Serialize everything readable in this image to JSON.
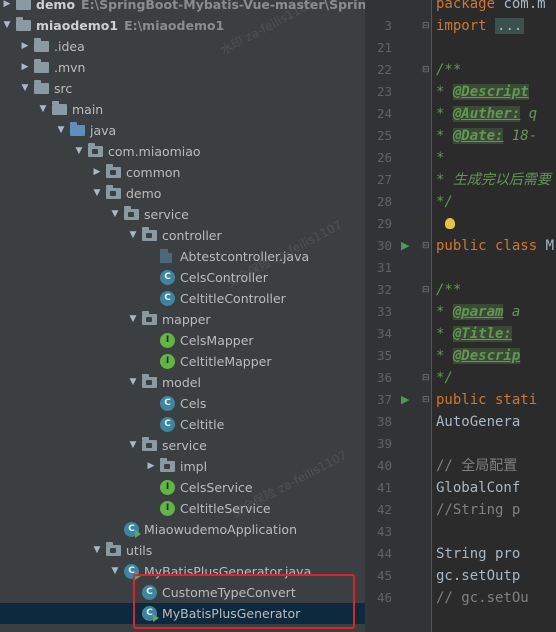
{
  "tree": {
    "items": [
      {
        "label": "demo",
        "path": "E:\\SpringBoot-Mybatis-Vue-master\\SpringBoot",
        "type": "module",
        "arrow": "right",
        "depth": 0,
        "bold": true
      },
      {
        "label": "miaodemo1",
        "path": "E:\\miaodemo1",
        "type": "module",
        "arrow": "down",
        "depth": 0,
        "bold": true
      },
      {
        "label": ".idea",
        "type": "folder",
        "arrow": "right",
        "depth": 1
      },
      {
        "label": ".mvn",
        "type": "folder",
        "arrow": "right",
        "depth": 1
      },
      {
        "label": "src",
        "type": "folder",
        "arrow": "down",
        "depth": 1
      },
      {
        "label": "main",
        "type": "folder",
        "arrow": "down",
        "depth": 2
      },
      {
        "label": "java",
        "type": "folder-blue",
        "arrow": "down",
        "depth": 3
      },
      {
        "label": "com.miaomiao",
        "type": "package",
        "arrow": "down",
        "depth": 4
      },
      {
        "label": "common",
        "type": "package",
        "arrow": "right",
        "depth": 5
      },
      {
        "label": "demo",
        "type": "package",
        "arrow": "down",
        "depth": 5
      },
      {
        "label": "service",
        "type": "package",
        "arrow": "down",
        "depth": 6
      },
      {
        "label": "controller",
        "type": "package",
        "arrow": "down",
        "depth": 7
      },
      {
        "label": "Abtestcontroller.java",
        "type": "java-file",
        "arrow": "",
        "depth": 8
      },
      {
        "label": "CelsController",
        "type": "class",
        "arrow": "",
        "depth": 8
      },
      {
        "label": "CeltitleController",
        "type": "class",
        "arrow": "",
        "depth": 8
      },
      {
        "label": "mapper",
        "type": "package",
        "arrow": "down",
        "depth": 7
      },
      {
        "label": "CelsMapper",
        "type": "interface",
        "arrow": "",
        "depth": 8
      },
      {
        "label": "CeltitleMapper",
        "type": "interface",
        "arrow": "",
        "depth": 8
      },
      {
        "label": "model",
        "type": "package",
        "arrow": "down",
        "depth": 7
      },
      {
        "label": "Cels",
        "type": "class",
        "arrow": "",
        "depth": 8
      },
      {
        "label": "Celtitle",
        "type": "class",
        "arrow": "",
        "depth": 8
      },
      {
        "label": "service",
        "type": "package",
        "arrow": "down",
        "depth": 7
      },
      {
        "label": "impl",
        "type": "package",
        "arrow": "right",
        "depth": 8
      },
      {
        "label": "CelsService",
        "type": "interface",
        "arrow": "",
        "depth": 8
      },
      {
        "label": "CeltitleService",
        "type": "interface",
        "arrow": "",
        "depth": 8
      },
      {
        "label": "MiaowudemoApplication",
        "type": "runnable-class",
        "arrow": "",
        "depth": 6
      },
      {
        "label": "utils",
        "type": "package",
        "arrow": "down",
        "depth": 5
      },
      {
        "label": "MyBatisPlusGenerator.java",
        "type": "runnable-class",
        "arrow": "down",
        "depth": 6
      },
      {
        "label": "CustomeTypeConvert",
        "type": "class",
        "arrow": "",
        "depth": 7
      },
      {
        "label": "MyBatisPlusGenerator",
        "type": "runnable-class",
        "arrow": "",
        "depth": 7,
        "selected": true
      }
    ],
    "watermarks": [
      "水印 za-feilis1107",
      "安全保险 za-feilis1107",
      "安全保险 za-feilis1107"
    ]
  },
  "editor": {
    "lines": [
      {
        "num": "",
        "segments": [
          {
            "t": "kw",
            "v": "package "
          },
          {
            "t": "",
            "v": "com.m"
          }
        ]
      },
      {
        "num": "3",
        "segments": [
          {
            "t": "kw",
            "v": "import "
          },
          {
            "t": "fold",
            "v": "..."
          }
        ]
      },
      {
        "num": "21",
        "segments": []
      },
      {
        "num": "22",
        "segments": [
          {
            "t": "cm",
            "v": "/**"
          }
        ]
      },
      {
        "num": "23",
        "segments": [
          {
            "t": "cm",
            "v": " * "
          },
          {
            "t": "tag",
            "v": "@Descript"
          }
        ]
      },
      {
        "num": "24",
        "segments": [
          {
            "t": "cm",
            "v": " * "
          },
          {
            "t": "tag",
            "v": "@Auther:"
          },
          {
            "t": "cm",
            "v": " q"
          }
        ]
      },
      {
        "num": "25",
        "segments": [
          {
            "t": "cm",
            "v": " * "
          },
          {
            "t": "tag",
            "v": "@Date:"
          },
          {
            "t": "cm",
            "v": " 18-"
          }
        ]
      },
      {
        "num": "26",
        "segments": [
          {
            "t": "cm",
            "v": " *"
          }
        ]
      },
      {
        "num": "27",
        "segments": [
          {
            "t": "cm",
            "v": " * 生成完以后需要"
          }
        ]
      },
      {
        "num": "28",
        "segments": [
          {
            "t": "cm",
            "v": " */"
          }
        ]
      },
      {
        "num": "29",
        "segments": []
      },
      {
        "num": "30",
        "segments": [
          {
            "t": "kw",
            "v": "public class "
          },
          {
            "t": "",
            "v": "M"
          }
        ]
      },
      {
        "num": "31",
        "segments": []
      },
      {
        "num": "32",
        "segments": [
          {
            "t": "cm",
            "v": "    /**"
          }
        ]
      },
      {
        "num": "33",
        "segments": [
          {
            "t": "cm",
            "v": "     * "
          },
          {
            "t": "tag",
            "v": "@param"
          },
          {
            "t": "cm",
            "v": " a"
          }
        ]
      },
      {
        "num": "34",
        "segments": [
          {
            "t": "cm",
            "v": "     * "
          },
          {
            "t": "tag",
            "v": "@Title:"
          }
        ]
      },
      {
        "num": "35",
        "segments": [
          {
            "t": "cm",
            "v": "     * "
          },
          {
            "t": "tag",
            "v": "@Descrip"
          }
        ]
      },
      {
        "num": "36",
        "segments": [
          {
            "t": "cm",
            "v": "     */"
          }
        ]
      },
      {
        "num": "37",
        "segments": [
          {
            "t": "kw",
            "v": "    public stati"
          }
        ]
      },
      {
        "num": "38",
        "segments": [
          {
            "t": "",
            "v": "        AutoGenera"
          }
        ]
      },
      {
        "num": "39",
        "segments": []
      },
      {
        "num": "40",
        "segments": [
          {
            "t": "gray",
            "v": "        // 全局配置"
          }
        ]
      },
      {
        "num": "41",
        "segments": [
          {
            "t": "",
            "v": "        GlobalConf"
          }
        ]
      },
      {
        "num": "42",
        "segments": [
          {
            "t": "gray",
            "v": "        //String p"
          }
        ]
      },
      {
        "num": "43",
        "segments": []
      },
      {
        "num": "44",
        "segments": [
          {
            "t": "",
            "v": "        String pro"
          }
        ]
      },
      {
        "num": "45",
        "segments": [
          {
            "t": "",
            "v": "        gc.setOutp"
          }
        ]
      },
      {
        "num": "46",
        "segments": [
          {
            "t": "gray",
            "v": "//      gc.setOu"
          }
        ]
      }
    ]
  }
}
